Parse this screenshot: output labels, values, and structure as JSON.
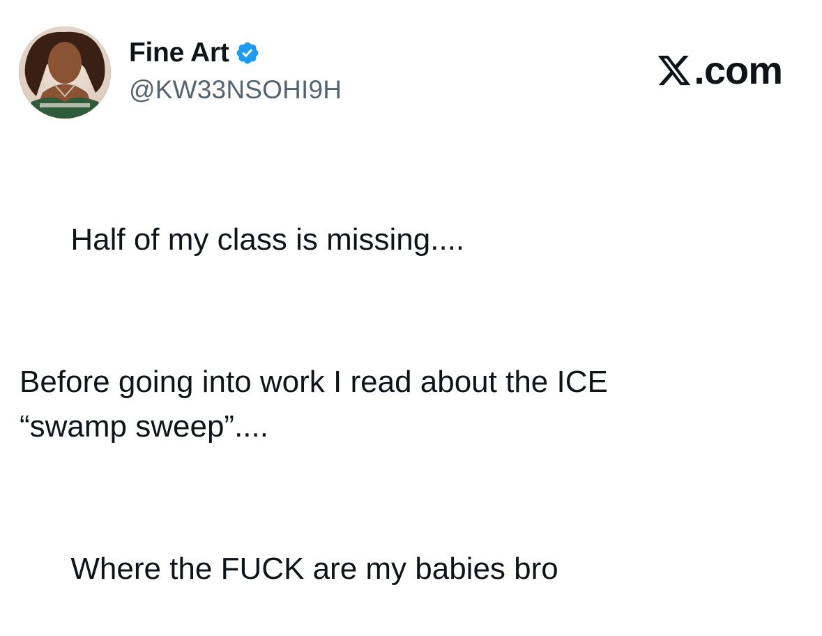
{
  "author": {
    "display_name": "Fine Art",
    "handle": "@KW33NSOHI9H",
    "verified": true,
    "avatar_icon": "profile-photo-avatar"
  },
  "brand": {
    "text": ".com",
    "logo_icon": "x-logo-icon"
  },
  "tweet": {
    "paragraphs": [
      [
        "Half of my class is missing...."
      ],
      [
        "Before going into work I read about the ICE",
        "“swamp sweep”...."
      ],
      [
        "Where the FUCK are my babies bro"
      ]
    ]
  },
  "colors": {
    "text": "#0f1419",
    "secondary_text": "#536471",
    "verified_blue": "#1d9bf0",
    "background": "#ffffff"
  }
}
